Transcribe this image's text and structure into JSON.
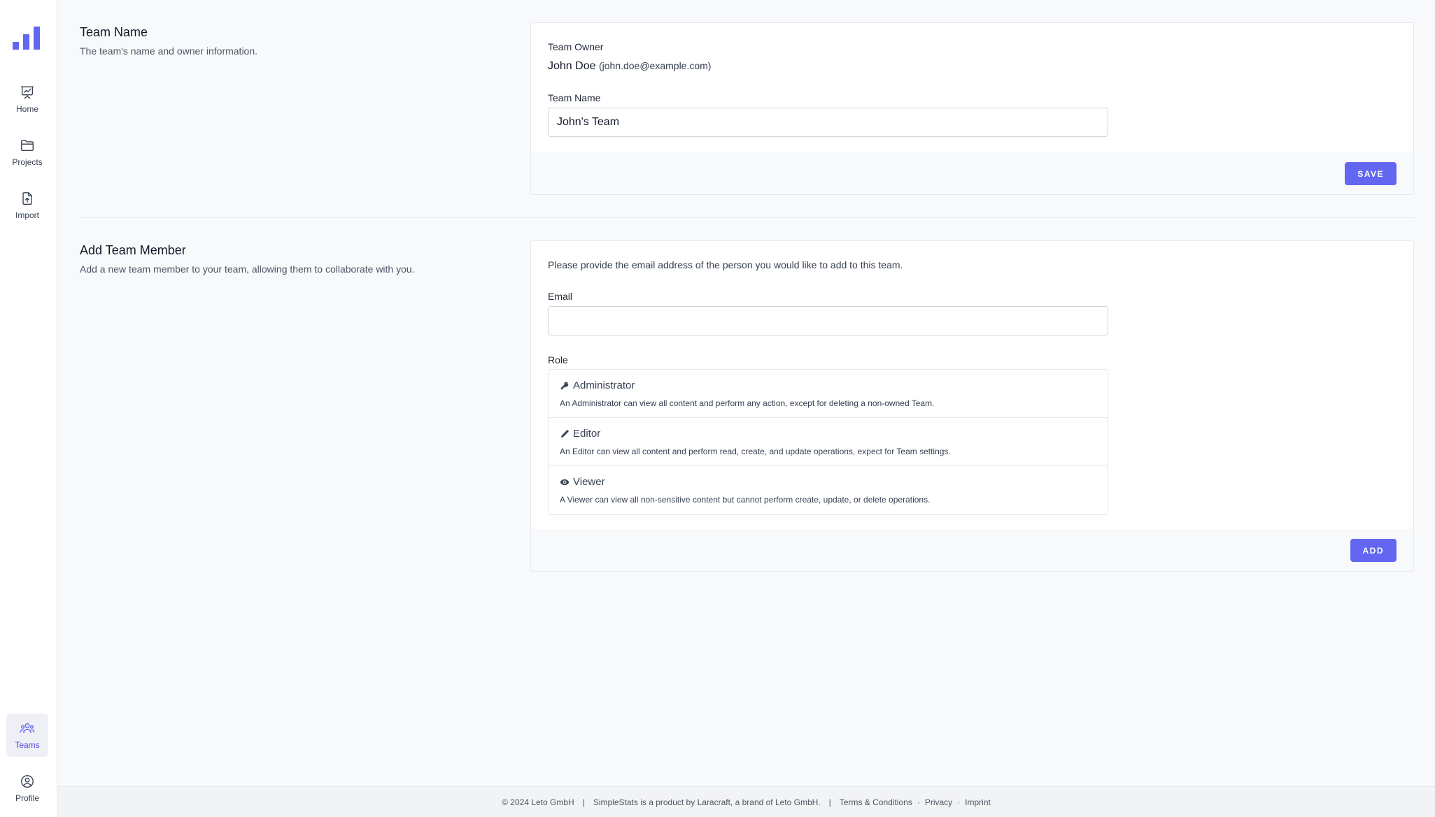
{
  "nav": {
    "home": "Home",
    "projects": "Projects",
    "import": "Import",
    "teams": "Teams",
    "profile": "Profile"
  },
  "team_name_section": {
    "title": "Team Name",
    "description": "The team's name and owner information.",
    "owner_label": "Team Owner",
    "owner_name": "John Doe",
    "owner_email": "(john.doe@example.com)",
    "name_label": "Team Name",
    "name_value": "John's Team",
    "save_label": "SAVE"
  },
  "add_member_section": {
    "title": "Add Team Member",
    "description": "Add a new team member to your team, allowing them to collaborate with you.",
    "intro": "Please provide the email address of the person you would like to add to this team.",
    "email_label": "Email",
    "email_value": "",
    "role_label": "Role",
    "roles": [
      {
        "name": "Administrator",
        "icon": "key-icon",
        "description": "An Administrator can view all content and perform any action, except for deleting a non-owned Team."
      },
      {
        "name": "Editor",
        "icon": "pencil-icon",
        "description": "An Editor can view all content and perform read, create, and update operations, expect for Team settings."
      },
      {
        "name": "Viewer",
        "icon": "eye-icon",
        "description": "A Viewer can view all non-sensitive content but cannot perform create, update, or delete operations."
      }
    ],
    "add_label": "ADD"
  },
  "footer": {
    "copyright": "© 2024 Leto GmbH",
    "tagline": "SimpleStats is a product by Laracraft, a brand of Leto GmbH.",
    "terms": "Terms & Conditions",
    "privacy": "Privacy",
    "imprint": "Imprint",
    "separator": "|",
    "dot": "·"
  },
  "colors": {
    "accent": "#6366f1",
    "background": "#f8f9fb",
    "border": "#e5e7eb"
  }
}
